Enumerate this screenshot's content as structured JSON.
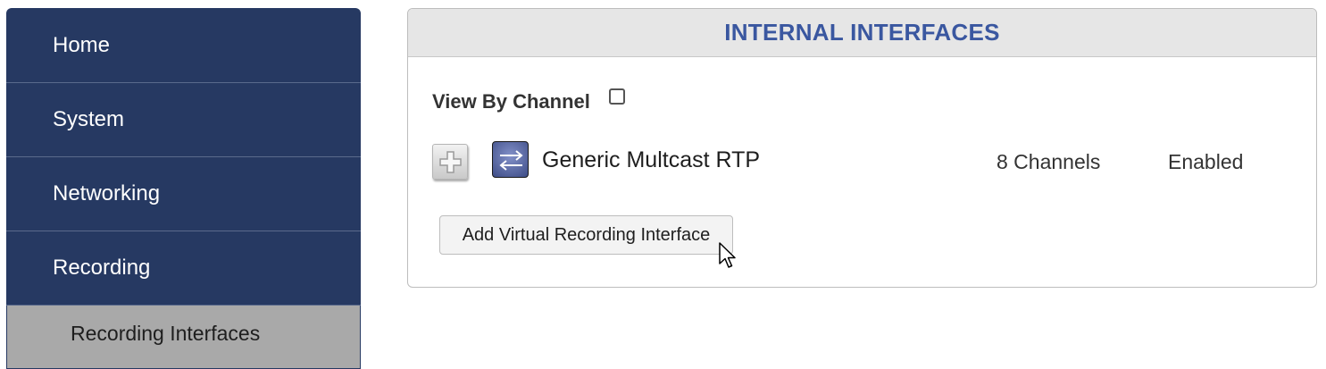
{
  "sidebar": {
    "items": [
      {
        "label": "Home"
      },
      {
        "label": "System"
      },
      {
        "label": "Networking"
      },
      {
        "label": "Recording"
      }
    ],
    "subitem": {
      "label": "Recording Interfaces"
    }
  },
  "panel": {
    "title": "INTERNAL INTERFACES",
    "view_by_label": "View By Channel",
    "view_by_checked": false,
    "interfaces": [
      {
        "name": "Generic Multcast RTP",
        "channels": "8 Channels",
        "status": "Enabled",
        "icon": "swap-arrows-icon"
      }
    ],
    "add_button_label": "Add Virtual Recording Interface"
  },
  "colors": {
    "sidebar_bg": "#263962",
    "sidebar_selected_bg": "#a9a9a9",
    "panel_title": "#3a57a0",
    "panel_header_bg": "#e6e6e6"
  }
}
